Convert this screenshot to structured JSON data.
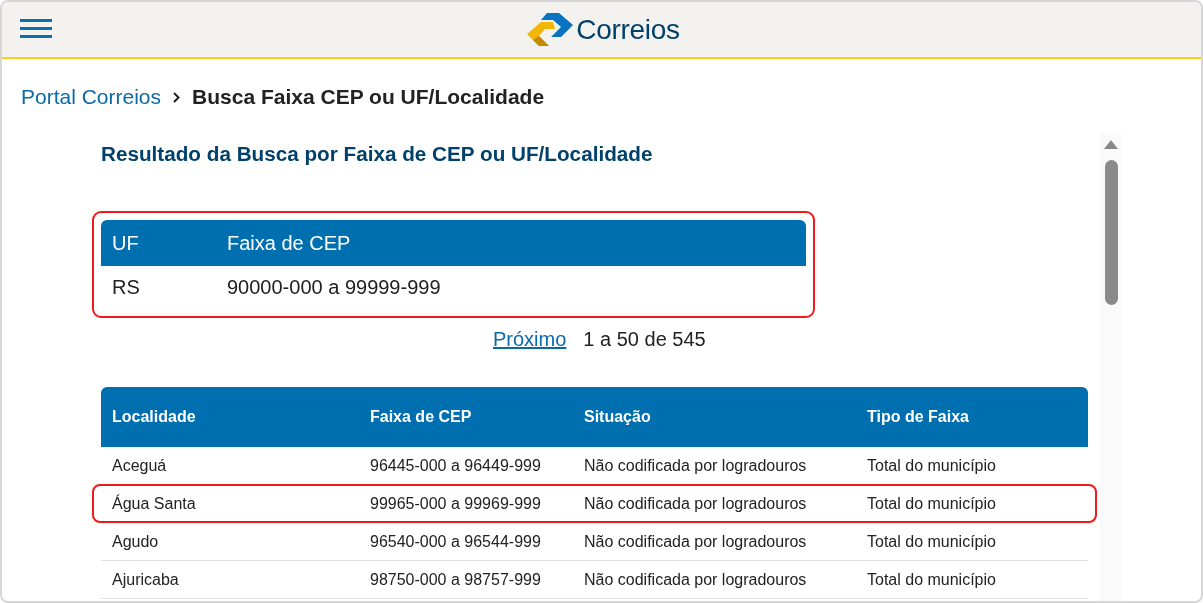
{
  "header": {
    "logo_text": "Correios"
  },
  "breadcrumb": [
    {
      "label": "Portal Correios",
      "kind": "link"
    },
    {
      "label": "Busca Faixa CEP ou UF/Localidade",
      "kind": "current"
    }
  ],
  "page_title": "Resultado da Busca por Faixa de CEP ou UF/Localidade",
  "uf_table": {
    "highlighted": true,
    "columns": [
      "UF",
      "Faixa de CEP"
    ],
    "rows": [
      [
        "RS",
        "90000-000 a 99999-999"
      ]
    ]
  },
  "pagination": {
    "next_link": "Próximo",
    "range": "1 a 50 de 545"
  },
  "locality_table": {
    "columns": [
      "Localidade",
      "Faixa de CEP",
      "Situação",
      "Tipo de Faixa"
    ],
    "rows": [
      {
        "cells": [
          "Aceguá",
          "96445-000 a 96449-999",
          "Não codificada por logradouros",
          "Total do município"
        ],
        "highlighted": false
      },
      {
        "cells": [
          "Água Santa",
          "99965-000 a 99969-999",
          "Não codificada por logradouros",
          "Total do município"
        ],
        "highlighted": true
      },
      {
        "cells": [
          "Agudo",
          "96540-000 a 96544-999",
          "Não codificada por logradouros",
          "Total do município"
        ],
        "highlighted": false
      },
      {
        "cells": [
          "Ajuricaba",
          "98750-000 a 98757-999",
          "Não codificada por logradouros",
          "Total do município"
        ],
        "highlighted": false
      }
    ]
  }
}
